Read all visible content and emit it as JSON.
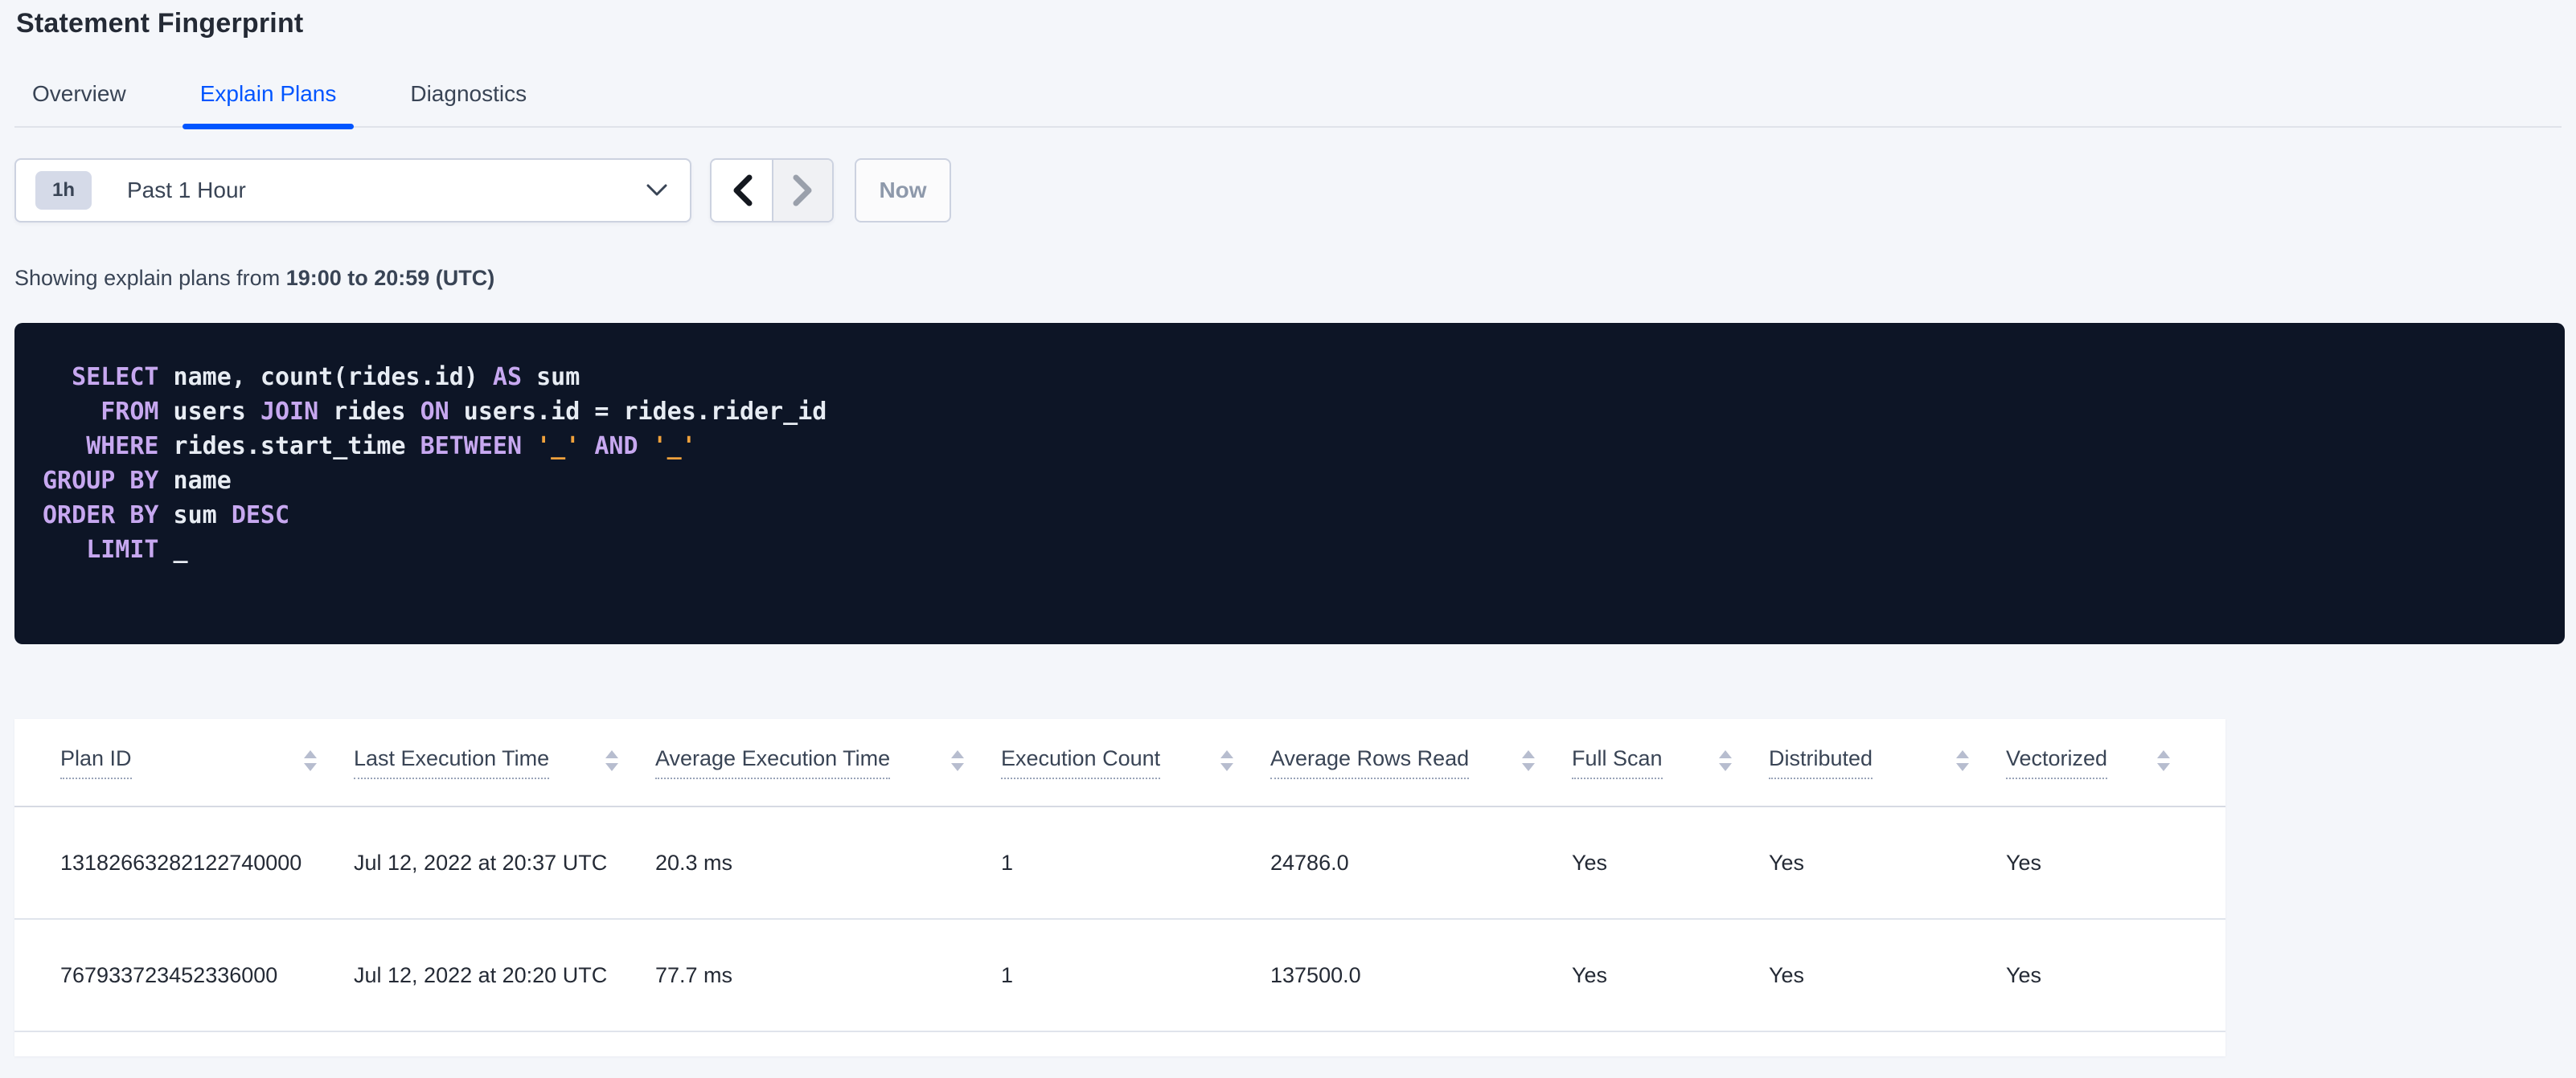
{
  "page": {
    "title": "Statement Fingerprint"
  },
  "tabs": [
    {
      "label": "Overview",
      "active": false
    },
    {
      "label": "Explain Plans",
      "active": true
    },
    {
      "label": "Diagnostics",
      "active": false
    }
  ],
  "time_picker": {
    "badge": "1h",
    "selected_label": "Past 1 Hour",
    "prev_icon": "chevron-left-icon",
    "next_icon": "chevron-right-icon",
    "now_label": "Now"
  },
  "subtitle": {
    "prefix": "Showing explain plans from ",
    "bold_range": "19:00 to 20:59 (UTC)"
  },
  "sql": {
    "lines": [
      [
        {
          "c": "pl",
          "t": "  "
        },
        {
          "c": "kw",
          "t": "SELECT"
        },
        {
          "c": "pl",
          "t": " name, count(rides.id) "
        },
        {
          "c": "kw",
          "t": "AS"
        },
        {
          "c": "pl",
          "t": " sum"
        }
      ],
      [
        {
          "c": "pl",
          "t": "    "
        },
        {
          "c": "kw",
          "t": "FROM"
        },
        {
          "c": "pl",
          "t": " users "
        },
        {
          "c": "kw",
          "t": "JOIN"
        },
        {
          "c": "pl",
          "t": " rides "
        },
        {
          "c": "kw",
          "t": "ON"
        },
        {
          "c": "pl",
          "t": " users.id = rides.rider_id"
        }
      ],
      [
        {
          "c": "pl",
          "t": "   "
        },
        {
          "c": "kw",
          "t": "WHERE"
        },
        {
          "c": "pl",
          "t": " rides.start_time "
        },
        {
          "c": "kw",
          "t": "BETWEEN"
        },
        {
          "c": "pl",
          "t": " "
        },
        {
          "c": "lit",
          "t": "'_'"
        },
        {
          "c": "pl",
          "t": " "
        },
        {
          "c": "kw",
          "t": "AND"
        },
        {
          "c": "pl",
          "t": " "
        },
        {
          "c": "lit",
          "t": "'_'"
        }
      ],
      [
        {
          "c": "kw",
          "t": "GROUP BY"
        },
        {
          "c": "pl",
          "t": " name"
        }
      ],
      [
        {
          "c": "kw",
          "t": "ORDER BY"
        },
        {
          "c": "pl",
          "t": " sum "
        },
        {
          "c": "kw",
          "t": "DESC"
        }
      ],
      [
        {
          "c": "pl",
          "t": "   "
        },
        {
          "c": "kw",
          "t": "LIMIT"
        },
        {
          "c": "pl",
          "t": " _"
        }
      ]
    ]
  },
  "table": {
    "columns": [
      {
        "key": "plan_id",
        "label": "Plan ID"
      },
      {
        "key": "last_execution_time",
        "label": "Last Execution Time"
      },
      {
        "key": "average_execution_time",
        "label": "Average Execution Time"
      },
      {
        "key": "execution_count",
        "label": "Execution Count"
      },
      {
        "key": "average_rows_read",
        "label": "Average Rows Read"
      },
      {
        "key": "full_scan",
        "label": "Full Scan"
      },
      {
        "key": "distributed",
        "label": "Distributed"
      },
      {
        "key": "vectorized",
        "label": "Vectorized"
      }
    ],
    "rows": [
      {
        "plan_id": "13182663282122740000",
        "last_execution_time": "Jul 12, 2022 at 20:37 UTC",
        "average_execution_time": "20.3 ms",
        "execution_count": "1",
        "average_rows_read": "24786.0",
        "full_scan": "Yes",
        "distributed": "Yes",
        "vectorized": "Yes"
      },
      {
        "plan_id": "767933723452336000",
        "last_execution_time": "Jul 12, 2022 at 20:20 UTC",
        "average_execution_time": "77.7 ms",
        "execution_count": "1",
        "average_rows_read": "137500.0",
        "full_scan": "Yes",
        "distributed": "Yes",
        "vectorized": "Yes"
      }
    ]
  },
  "icons": {
    "dropdown_chevron": "chevron-down-icon",
    "sort": "sort-arrows-icon"
  },
  "colors": {
    "accent_blue": "#0055ff",
    "page_bg": "#f4f6fa",
    "code_bg": "#0d1526",
    "code_keyword": "#c7a8f0",
    "code_identifier": "#e7ecf3",
    "code_literal": "#efa13c",
    "header_text": "#394455",
    "cell_text": "#242a35"
  }
}
